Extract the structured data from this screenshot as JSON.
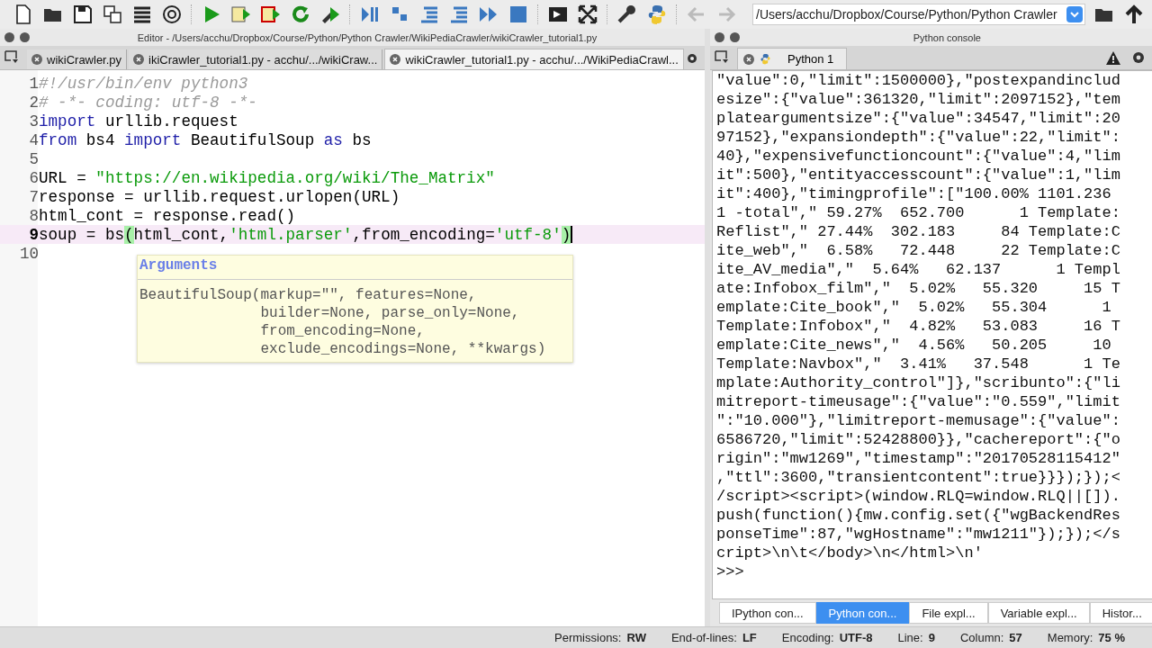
{
  "toolbar": {
    "path_field": {
      "value": "/Users/acchu/Dropbox/Course/Python/Python Crawler"
    }
  },
  "editor": {
    "title": "Editor - /Users/acchu/Dropbox/Course/Python/Python Crawler/WikiPediaCrawler/wikiCrawler_tutorial1.py",
    "tabs": [
      {
        "label": "wikiCrawler.py",
        "selected": false
      },
      {
        "label": "ikiCrawler_tutorial1.py - acchu/.../wikiCraw...",
        "selected": false
      },
      {
        "label": "wikiCrawler_tutorial1.py - acchu/.../WikiPediaCrawl...",
        "selected": true
      }
    ],
    "lines": [
      {
        "number": "1",
        "current": false,
        "tokens": [
          {
            "text": "#!/usr/bin/env python3",
            "kind": "comment"
          }
        ]
      },
      {
        "number": "2",
        "current": false,
        "tokens": [
          {
            "text": "# -*- coding: utf-8 -*-",
            "kind": "comment"
          }
        ]
      },
      {
        "number": "3",
        "current": false,
        "tokens": [
          {
            "text": "import",
            "kind": "keyword"
          },
          {
            "text": " urllib.request",
            "kind": "plain"
          }
        ]
      },
      {
        "number": "4",
        "current": false,
        "tokens": [
          {
            "text": "from",
            "kind": "keyword"
          },
          {
            "text": " bs4 ",
            "kind": "plain"
          },
          {
            "text": "import",
            "kind": "keyword"
          },
          {
            "text": " BeautifulSoup ",
            "kind": "plain"
          },
          {
            "text": "as",
            "kind": "keyword"
          },
          {
            "text": " bs",
            "kind": "plain"
          }
        ]
      },
      {
        "number": "5",
        "current": false
      },
      {
        "number": "6",
        "current": false,
        "tokens": [
          {
            "text": "URL = ",
            "kind": "plain"
          },
          {
            "text": "\"https://en.wikipedia.org/wiki/The_Matrix\"",
            "kind": "string"
          }
        ]
      },
      {
        "number": "7",
        "current": false,
        "tokens": [
          {
            "text": "response = urllib.request.urlopen(URL)",
            "kind": "plain"
          }
        ]
      },
      {
        "number": "8",
        "current": false,
        "tokens": [
          {
            "text": "html_cont = response.read()",
            "kind": "plain"
          }
        ]
      },
      {
        "number": "9",
        "current": true,
        "tokens": [
          {
            "text": "soup = bs",
            "kind": "plain"
          },
          {
            "text": "(",
            "kind": "bracket"
          },
          {
            "text": "html_cont,",
            "kind": "plain"
          },
          {
            "text": "'html.parser'",
            "kind": "string"
          },
          {
            "text": ",from_encoding=",
            "kind": "plain"
          },
          {
            "text": "'utf-8'",
            "kind": "string"
          },
          {
            "text": ")",
            "kind": "bracket"
          }
        ]
      },
      {
        "number": "10",
        "current": false
      }
    ],
    "calltip": {
      "title": "Arguments",
      "lines": [
        "BeautifulSoup(markup=\"\", features=None,",
        "              builder=None, parse_only=None,",
        "              from_encoding=None,",
        "              exclude_encodings=None, **kwargs)"
      ]
    }
  },
  "console": {
    "title": "Python console",
    "tab": "Python 1",
    "lines": [
      "\"value\":0,\"limit\":1500000},\"postexpandinclud",
      "esize\":{\"value\":361320,\"limit\":2097152},\"tem",
      "plateargumentsize\":{\"value\":34547,\"limit\":20",
      "97152},\"expansiondepth\":{\"value\":22,\"limit\":",
      "40},\"expensivefunctioncount\":{\"value\":4,\"lim",
      "it\":500},\"entityaccesscount\":{\"value\":1,\"lim",
      "it\":400},\"timingprofile\":[\"100.00% 1101.236",
      "1 -total\",\" 59.27%  652.700      1 Template:",
      "Reflist\",\" 27.44%  302.183     84 Template:C",
      "ite_web\",\"  6.58%   72.448     22 Template:C",
      "ite_AV_media\",\"  5.64%   62.137      1 Templ",
      "ate:Infobox_film\",\"  5.02%   55.320     15 T",
      "emplate:Cite_book\",\"  5.02%   55.304      1",
      "Template:Infobox\",\"  4.82%   53.083     16 T",
      "emplate:Cite_news\",\"  4.56%   50.205     10",
      "Template:Navbox\",\"  3.41%   37.548      1 Te",
      "mplate:Authority_control\"]},\"scribunto\":{\"li",
      "mitreport-timeusage\":{\"value\":\"0.559\",\"limit",
      "\":\"10.000\"},\"limitreport-memusage\":{\"value\":",
      "6586720,\"limit\":52428800}},\"cachereport\":{\"o",
      "rigin\":\"mw1269\",\"timestamp\":\"20170528115412\"",
      ",\"ttl\":3600,\"transientcontent\":true}}});});<",
      "/script><script>(window.RLQ=window.RLQ||[]).",
      "push(function(){mw.config.set({\"wgBackendRes",
      "ponseTime\":87,\"wgHostname\":\"mw1211\"});});</s",
      "cript>\\n\\t</body>\\n</html>\\n'"
    ],
    "prompt": ">>>"
  },
  "bottom_tabs": [
    {
      "label": "IPython con...",
      "selected": false
    },
    {
      "label": "Python con...",
      "selected": true
    },
    {
      "label": "File expl...",
      "selected": false
    },
    {
      "label": "Variable expl...",
      "selected": false
    },
    {
      "label": "Histor...",
      "selected": false
    }
  ],
  "status_bar": [
    {
      "label": "Permissions:",
      "value": "RW"
    },
    {
      "label": "End-of-lines:",
      "value": "LF"
    },
    {
      "label": "Encoding:",
      "value": "UTF-8"
    },
    {
      "label": "Line:",
      "value": "9"
    },
    {
      "label": "Column:",
      "value": "57"
    },
    {
      "label": "Memory:",
      "value": "75 %"
    }
  ]
}
